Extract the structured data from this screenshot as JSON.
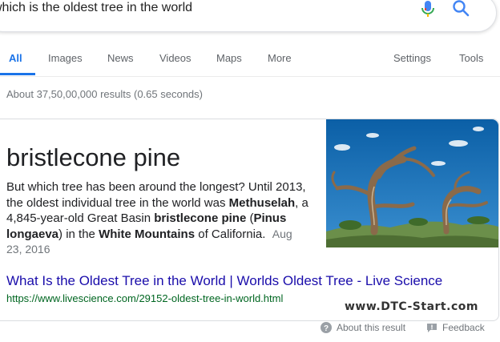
{
  "search": {
    "query": "which is the oldest tree in the world",
    "mic_icon": "mic-icon",
    "search_icon": "search-icon"
  },
  "tabs": [
    {
      "label": "All",
      "active": true
    },
    {
      "label": "Images"
    },
    {
      "label": "News"
    },
    {
      "label": "Videos"
    },
    {
      "label": "Maps"
    },
    {
      "label": "More"
    }
  ],
  "tools": {
    "settings": "Settings",
    "tools": "Tools"
  },
  "result_stats": "About 37,50,00,000 results (0.65 seconds)",
  "featured": {
    "title": "bristlecone pine",
    "snippet": {
      "p1": "But which tree has been around the longest? Until 2013, the oldest individual tree in the world was ",
      "b1": "Methuselah",
      "p2": ", a 4,845-year-old Great Basin ",
      "b2": "bristlecone pine",
      "p3": " (",
      "b3": "Pinus longaeva",
      "p4": ") in the ",
      "b4": "White Mountains",
      "p5": " of California.",
      "date": "Aug 23, 2016"
    },
    "link_text": "What Is the Oldest Tree in the World | Worlds Oldest Tree - Live Science",
    "url": "https://www.livescience.com/29152-oldest-tree-in-world.html",
    "watermark": "www.DTC-Start.com"
  },
  "footer": {
    "about": "About this result",
    "feedback": "Feedback"
  },
  "colors": {
    "accent": "#1a73e8",
    "link": "#1a0dab",
    "url": "#006621",
    "muted": "#70757a"
  }
}
